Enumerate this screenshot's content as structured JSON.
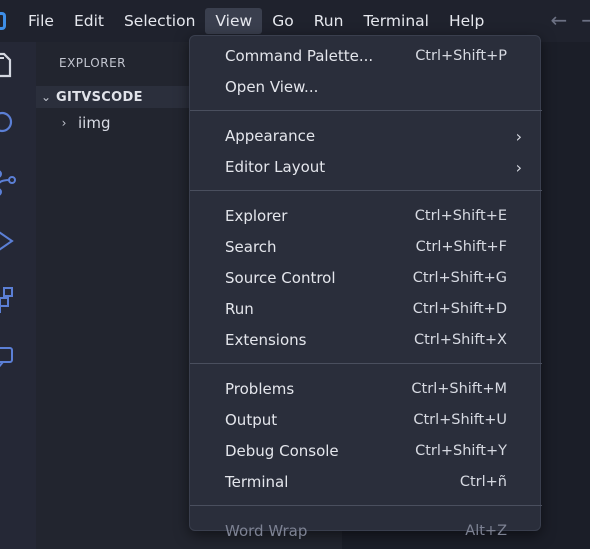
{
  "menubar": {
    "items": [
      "File",
      "Edit",
      "Selection",
      "View",
      "Go",
      "Run",
      "Terminal",
      "Help"
    ],
    "active": "View"
  },
  "nav": {
    "back": "←",
    "forward": "→"
  },
  "sidebar": {
    "title": "EXPLORER",
    "folder": "GITVSCODE",
    "subfolder": "iimg"
  },
  "view_menu": {
    "groups": [
      [
        {
          "label": "Command Palette...",
          "shortcut": "Ctrl+Shift+P"
        },
        {
          "label": "Open View...",
          "shortcut": ""
        }
      ],
      [
        {
          "label": "Appearance",
          "submenu": true
        },
        {
          "label": "Editor Layout",
          "submenu": true
        }
      ],
      [
        {
          "label": "Explorer",
          "shortcut": "Ctrl+Shift+E"
        },
        {
          "label": "Search",
          "shortcut": "Ctrl+Shift+F"
        },
        {
          "label": "Source Control",
          "shortcut": "Ctrl+Shift+G"
        },
        {
          "label": "Run",
          "shortcut": "Ctrl+Shift+D"
        },
        {
          "label": "Extensions",
          "shortcut": "Ctrl+Shift+X"
        }
      ],
      [
        {
          "label": "Problems",
          "shortcut": "Ctrl+Shift+M"
        },
        {
          "label": "Output",
          "shortcut": "Ctrl+Shift+U"
        },
        {
          "label": "Debug Console",
          "shortcut": "Ctrl+Shift+Y"
        },
        {
          "label": "Terminal",
          "shortcut": "Ctrl+ñ"
        }
      ],
      [
        {
          "label": "Word Wrap",
          "shortcut": "Alt+Z",
          "disabled": true
        }
      ]
    ]
  },
  "colors": {
    "accent": "#3e8ee6",
    "menu_bg": "#2a2e3b",
    "activity_icon": "#5b7fd6"
  }
}
